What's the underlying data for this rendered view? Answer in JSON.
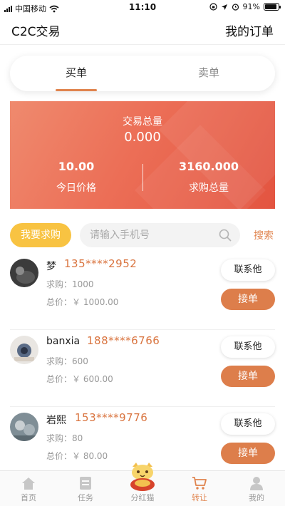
{
  "status_bar": {
    "carrier": "中国移动",
    "time": "11:10",
    "battery": "91%",
    "battery_level": 0.91
  },
  "header": {
    "title": "C2C交易",
    "my_orders": "我的订单"
  },
  "tabs": [
    {
      "label": "买单",
      "active": true
    },
    {
      "label": "卖单",
      "active": false
    }
  ],
  "stats": {
    "total_label": "交易总量",
    "total_value": "0.000",
    "price_value": "10.00",
    "price_label": "今日价格",
    "purchase_value": "3160.000",
    "purchase_label": "求购总量"
  },
  "search": {
    "request_button": "我要求购",
    "placeholder": "请输入手机号",
    "search_label": "搜索"
  },
  "orders": [
    {
      "name": "梦",
      "phone": "135****2952",
      "qty": "求购：1000",
      "total": "总价：￥ 1000.00",
      "contact": "联系他",
      "accept": "接单"
    },
    {
      "name": "banxia",
      "phone": "188****6766",
      "qty": "求购：600",
      "total": "总价：￥ 600.00",
      "contact": "联系他",
      "accept": "接单"
    },
    {
      "name": "岩熙",
      "phone": "153****9776",
      "qty": "求购：80",
      "total": "总价：￥ 80.00",
      "contact": "联系他",
      "accept": "接单"
    }
  ],
  "tab_bar": [
    {
      "label": "首页",
      "icon": "home-icon",
      "active": false
    },
    {
      "label": "任务",
      "icon": "task-icon",
      "active": false
    },
    {
      "label": "分红猫",
      "icon": "lucky-cat-icon",
      "active": false
    },
    {
      "label": "转让",
      "icon": "cart-icon",
      "active": true
    },
    {
      "label": "我的",
      "icon": "profile-icon",
      "active": false
    }
  ],
  "colors": {
    "accent": "#e0844e",
    "banner_start": "#ef8a6e",
    "banner_end": "#e35440",
    "request_button": "#f8c342"
  }
}
